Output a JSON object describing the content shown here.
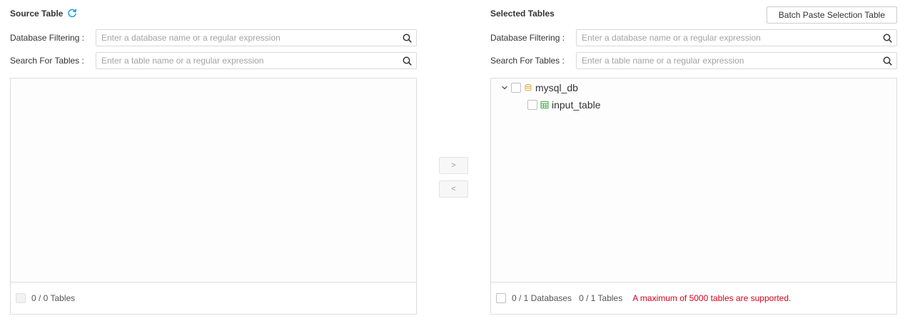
{
  "colors": {
    "accent": "#1fa2e0",
    "warning": "#d9001b",
    "database_icon": "#e8b04a",
    "table_icon": "#4caf50"
  },
  "source": {
    "title": "Source Table",
    "title_icon": "refresh-icon",
    "db_filter": {
      "label": "Database Filtering :",
      "value": "",
      "placeholder": "Enter a database name or a regular expression",
      "icon": "search-icon"
    },
    "table_search": {
      "label": "Search For Tables :",
      "value": "",
      "placeholder": "Enter a table name or a regular expression",
      "icon": "search-icon"
    },
    "items": [],
    "footer": {
      "count": "0 / 0 Tables"
    }
  },
  "transfer": {
    "move_right": ">",
    "move_left": "<"
  },
  "selected": {
    "title": "Selected Tables",
    "batch_button": "Batch Paste Selection Table",
    "db_filter": {
      "label": "Database Filtering :",
      "value": "",
      "placeholder": "Enter a database name or a regular expression",
      "icon": "search-icon"
    },
    "table_search": {
      "label": "Search For Tables :",
      "value": "",
      "placeholder": "Enter a table name or a regular expression",
      "icon": "search-icon"
    },
    "tree": {
      "database": {
        "label": "mysql_db",
        "expanded": true,
        "checked": false,
        "icon": "database-icon"
      },
      "table": {
        "label": "input_table",
        "checked": false,
        "icon": "table-icon"
      }
    },
    "footer": {
      "db_count": "0 / 1 Databases",
      "table_count": "0 / 1 Tables",
      "warning": "A maximum of 5000 tables are supported."
    }
  }
}
